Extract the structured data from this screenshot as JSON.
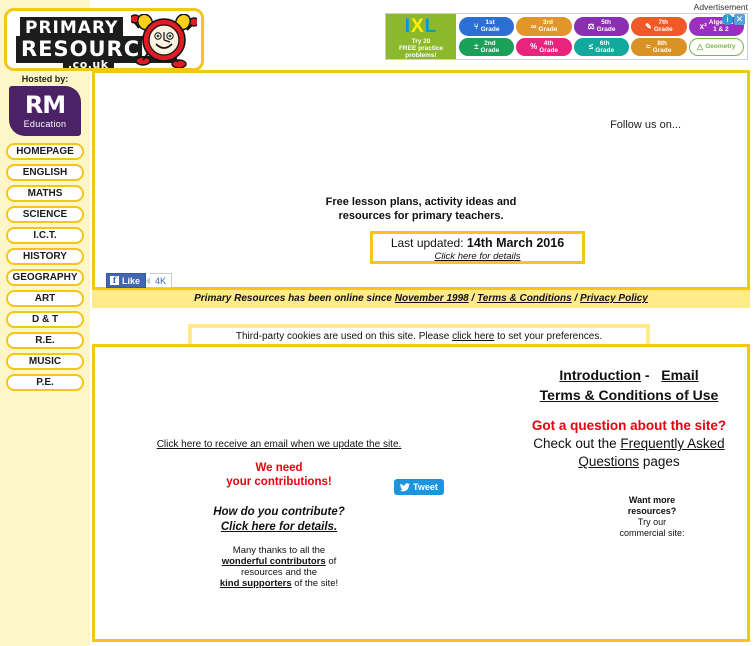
{
  "sidebar": {
    "logo": {
      "line1": "PRIMARY",
      "line2": "RESOURCES",
      "line3": ".co.uk"
    },
    "hosted_by_label": "Hosted by:",
    "host": {
      "name": "RM",
      "tagline": "Education"
    },
    "items": [
      {
        "label": "HOMEPAGE"
      },
      {
        "label": "ENGLISH"
      },
      {
        "label": "MATHS"
      },
      {
        "label": "SCIENCE"
      },
      {
        "label": "I.C.T."
      },
      {
        "label": "HISTORY"
      },
      {
        "label": "GEOGRAPHY"
      },
      {
        "label": "ART"
      },
      {
        "label": "D & T"
      },
      {
        "label": "R.E."
      },
      {
        "label": "MUSIC"
      },
      {
        "label": "P.E."
      }
    ]
  },
  "ad": {
    "label": "Advertisement",
    "brand": "IXL",
    "brand_sub_line1": "Try 20",
    "brand_sub_line2": "FREE practice",
    "brand_sub_line3": "problems!",
    "pills": [
      {
        "icon": "⑂",
        "line1": "1st",
        "line2": "Grade",
        "color": "#2b6fd4"
      },
      {
        "icon": "∞",
        "line1": "3rd",
        "line2": "Grade",
        "color": "#e0962a"
      },
      {
        "icon": "⚖",
        "line1": "5th",
        "line2": "Grade",
        "color": "#8a2fb0"
      },
      {
        "icon": "✎",
        "line1": "7th",
        "line2": "Grade",
        "color": "#f05a28"
      },
      {
        "icon": "x²",
        "line1": "Algebra",
        "line2": "1 & 2",
        "color": "#9b30c0"
      },
      {
        "icon": "±",
        "line1": "2nd",
        "line2": "Grade",
        "color": "#1ba05a"
      },
      {
        "icon": "%",
        "line1": "4th",
        "line2": "Grade",
        "color": "#e8247f"
      },
      {
        "icon": "≤",
        "line1": "6th",
        "line2": "Grade",
        "color": "#12a89b"
      },
      {
        "icon": "≈",
        "line1": "8th",
        "line2": "Grade",
        "color": "#d99224"
      },
      {
        "icon": "△",
        "line1": "Geometry",
        "line2": "",
        "color": "#7ab648"
      }
    ],
    "info_icon": "i",
    "close_icon": "✕"
  },
  "top_panel": {
    "follow_us": "Follow us on...",
    "tagline_line1": "Free lesson plans, activity ideas and",
    "tagline_line2": "resources for primary teachers.",
    "updated_prefix": "Last updated:",
    "updated_date": "14th March 2016",
    "updated_details_link": "Click here for details",
    "facebook": {
      "label": "Like",
      "count": "4K"
    }
  },
  "since_bar": {
    "prefix": "Primary Resources has been online since",
    "since_link": "November 1998",
    "sep": "/",
    "terms_link": "Terms & Conditions",
    "privacy_link": "Privacy Policy"
  },
  "cookie_bar": {
    "text_before": "Third-party cookies are used on this site. Please",
    "link": "click here",
    "text_after": "to set your preferences."
  },
  "bottom_panel": {
    "intro_link": "Introduction",
    "dash": "-",
    "email_link": "Email",
    "terms_of_use_link": "Terms & Conditions of Use",
    "question_headline": "Got a question about the site?",
    "check_out_prefix": "Check out the",
    "faq_link": "Frequently Asked Questions",
    "pages_suffix": "pages",
    "want_more_line1": "Want more",
    "want_more_line2": "resources?",
    "want_more_line3": "Try our",
    "want_more_line4": "commercial site:",
    "email_update_link": "Click here to receive an email when we update the site.",
    "need_line1": "We need",
    "need_line2": "your contributions!",
    "how_line1": "How do you contribute?",
    "how_line2": "Click here for details.",
    "thanks_line1": "Many thanks to all the",
    "thanks_contributors_link": "wonderful contributors",
    "thanks_line2": "of",
    "thanks_line3": "resources and the",
    "thanks_supporters_link": "kind supporters",
    "thanks_line4": "of the site!",
    "tweet_label": "Tweet"
  },
  "colors": {
    "brand_yellow": "#f5c518",
    "pale_yellow": "#fdf6c8",
    "bar_yellow": "#ffeb8a",
    "red": "#e8000d",
    "facebook_blue": "#4267b2",
    "twitter_blue": "#1b95e0",
    "rm_purple": "#4b2266"
  }
}
